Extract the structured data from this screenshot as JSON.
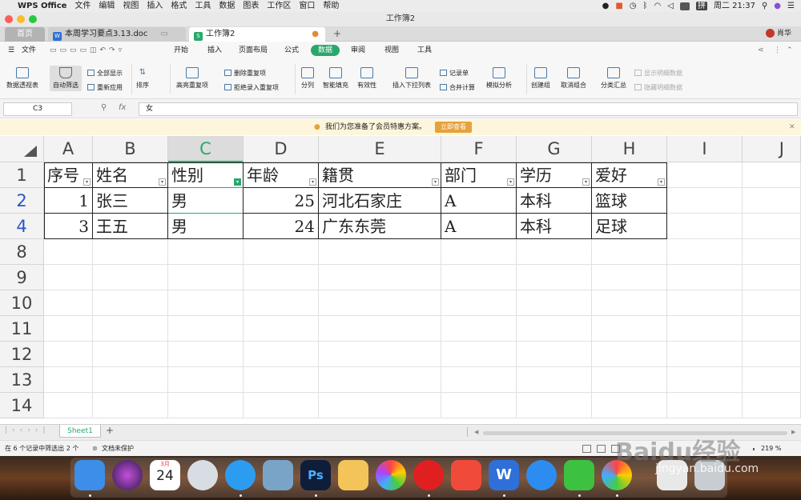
{
  "menubar": {
    "app": "WPS Office",
    "items": [
      "文件",
      "编辑",
      "视图",
      "插入",
      "格式",
      "工具",
      "数据",
      "图表",
      "工作区",
      "窗口",
      "帮助"
    ],
    "input_method": "拼",
    "clock": "周二 21:37"
  },
  "window": {
    "title": "工作簿2"
  },
  "tabs": {
    "home": "首页",
    "doc": "本周学习要点3.13.doc",
    "book": "工作簿2",
    "user": "肖华"
  },
  "ribbon_menu": {
    "file": "文件",
    "items": [
      "开始",
      "插入",
      "页面布局",
      "公式",
      "数据",
      "审阅",
      "视图",
      "工具"
    ]
  },
  "ribbon": {
    "pivot": "数据透视表",
    "autofilter": "自动筛选",
    "show_all": "全部显示",
    "reapply": "重新应用",
    "sort": "排序",
    "highlight_dup": "高亮重复项",
    "remove_dup": "删除重复项",
    "reject_dup": "拒绝录入重复项",
    "split": "分列",
    "smart_fill": "智能填充",
    "validity": "有效性",
    "dropdown": "插入下拉列表",
    "record": "记录单",
    "merge_calc": "合并计算",
    "simulate": "模拟分析",
    "group": "创建组",
    "ungroup": "取消组合",
    "subtotal": "分类汇总",
    "show_detail": "显示明细数据",
    "hide_detail": "隐藏明细数据"
  },
  "formula_bar": {
    "cell_ref": "C3",
    "fx": "fx",
    "value": "女"
  },
  "notice": {
    "text": "我们为您准备了会员特惠方案。",
    "button": "立即查看"
  },
  "grid": {
    "columns": [
      "A",
      "B",
      "C",
      "D",
      "E",
      "F",
      "G",
      "H",
      "I",
      "J"
    ],
    "row_numbers": [
      "1",
      "2",
      "4",
      "8",
      "9",
      "10",
      "11",
      "12",
      "13",
      "14"
    ],
    "header": [
      "序号",
      "姓名",
      "性别",
      "年龄",
      "籍贯",
      "部门",
      "学历",
      "爱好"
    ],
    "rows": [
      [
        "1",
        "张三",
        "男",
        "25",
        "河北石家庄",
        "A",
        "本科",
        "篮球"
      ],
      [
        "3",
        "王五",
        "男",
        "24",
        "广东东莞",
        "A",
        "本科",
        "足球"
      ]
    ]
  },
  "sheets": {
    "active": "Sheet1",
    "add": "+"
  },
  "status": {
    "filter_text": "在 6 个记录中筛选出 2 个",
    "protect": "文档未保护",
    "zoom": "219 %"
  },
  "watermark": {
    "brand": "Baidu经验",
    "url": "jingyan.baidu.com"
  },
  "dock": {
    "calendar_month": "3月",
    "calendar_day": "24"
  }
}
